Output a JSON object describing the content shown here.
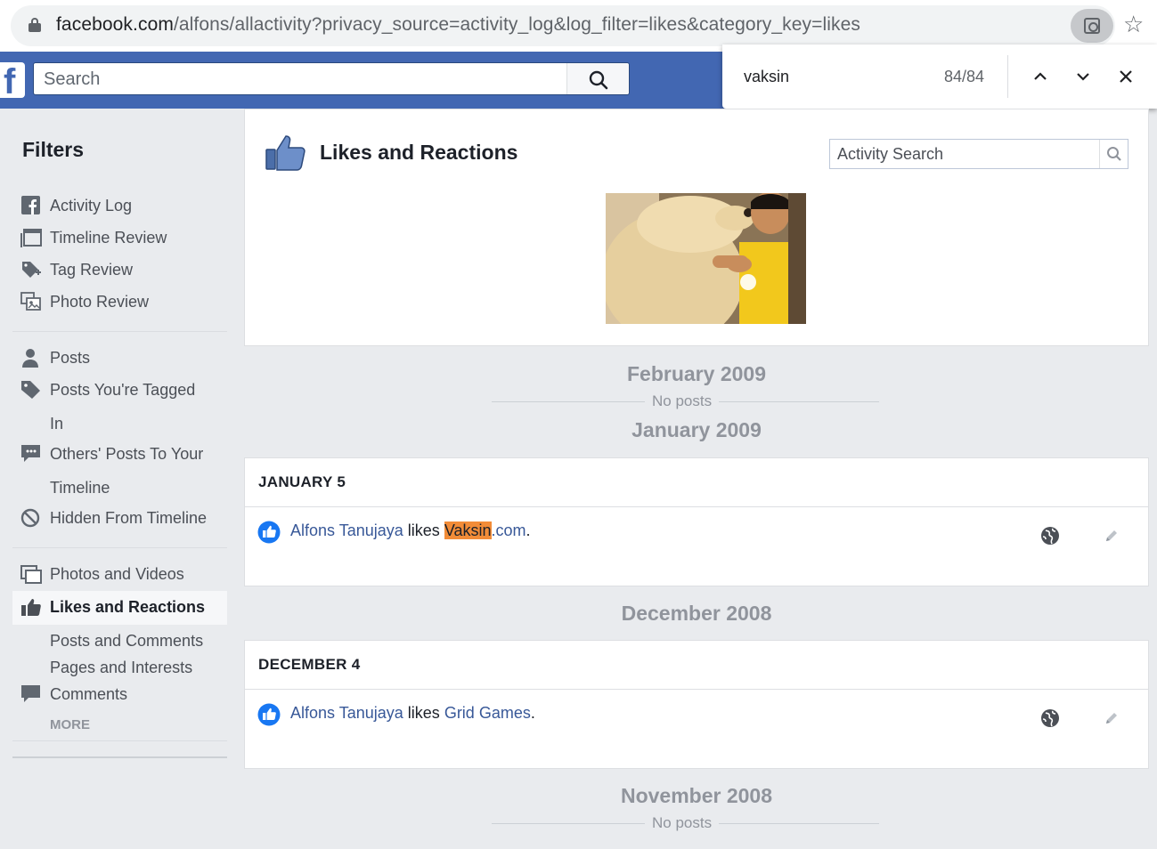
{
  "browser": {
    "url_host": "facebook.com",
    "url_path": "/alfons/allactivity?privacy_source=activity_log&log_filter=likes&category_key=likes"
  },
  "fb": {
    "logo_letter": "f",
    "search_placeholder": "Search",
    "brand_color": "#4267b2"
  },
  "find_bar": {
    "term": "vaksin",
    "count": "84/84"
  },
  "sidebar": {
    "title": "Filters",
    "items": [
      {
        "label": "Activity Log",
        "icon": "facebook-square-icon"
      },
      {
        "label": "Timeline Review",
        "icon": "timeline-review-icon"
      },
      {
        "label": "Tag Review",
        "icon": "tag-review-icon"
      },
      {
        "label": "Photo Review",
        "icon": "photo-review-icon"
      },
      {
        "label": "Posts",
        "icon": "person-icon"
      },
      {
        "label": "Posts You're Tagged",
        "label2": "In",
        "icon": "tag-icon"
      },
      {
        "label": "Others' Posts To Your",
        "label2": "Timeline",
        "icon": "speech-bubble-icon"
      },
      {
        "label": "Hidden From Timeline",
        "icon": "hidden-icon"
      },
      {
        "label": "Photos and Videos",
        "icon": "photos-icon"
      },
      {
        "label": "Likes and Reactions",
        "icon": "thumbs-up-icon"
      },
      {
        "label": "Comments",
        "icon": "comment-icon"
      }
    ],
    "subitems": [
      "Posts and Comments",
      "Pages and Interests"
    ],
    "more": "MORE"
  },
  "header": {
    "title": "Likes and Reactions",
    "search_placeholder": "Activity Search"
  },
  "timeline": {
    "months": [
      "February 2009",
      "January 2009",
      "December 2008",
      "November 2008"
    ],
    "no_posts": "No posts",
    "entries": [
      {
        "date": "JANUARY 5",
        "actor": "Alfons Tanujaya",
        "verb": "likes",
        "target_highlight": "Vaksin",
        "target_rest": ".com",
        "suffix": "."
      },
      {
        "date": "DECEMBER 4",
        "actor": "Alfons Tanujaya",
        "verb": "likes",
        "target": "Grid Games",
        "suffix": "."
      }
    ]
  },
  "colors": {
    "highlight": "#f28c38",
    "link": "#385898",
    "like_blue": "#1877f2"
  }
}
